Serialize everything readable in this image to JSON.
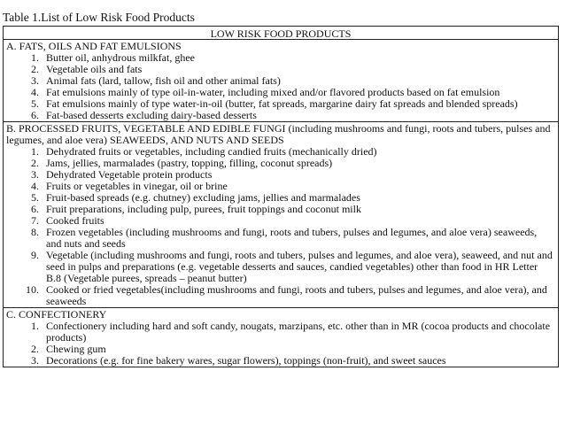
{
  "caption": "Table 1.List of Low Risk Food Products",
  "table_header": "LOW RISK FOOD PRODUCTS",
  "sections": [
    {
      "title": "A. FATS, OILS AND FAT EMULSIONS",
      "items": [
        {
          "num": "1.",
          "text": "Butter oil, anhydrous milkfat, ghee"
        },
        {
          "num": "2.",
          "text": "Vegetable oils and fats"
        },
        {
          "num": "3.",
          "text": "Animal fats (lard, tallow, fish oil and other animal fats)"
        },
        {
          "num": "4.",
          "text": "Fat emulsions mainly of type oil-in-water, including mixed and/or flavored products based on fat emulsion"
        },
        {
          "num": "5.",
          "text": "Fat emulsions mainly of type water-in-oil (butter, fat spreads, margarine dairy fat spreads and blended spreads)"
        },
        {
          "num": "6.",
          "text": "Fat-based desserts excluding dairy-based desserts"
        }
      ]
    },
    {
      "title": "B. PROCESSED FRUITS, VEGETABLE AND EDIBLE FUNGI (including mushrooms and  fungi, roots and tubers, pulses and legumes, and aloe vera) SEAWEEDS, AND NUTS AND SEEDS",
      "items": [
        {
          "num": "1.",
          "text": "Dehydrated fruits or vegetables, including candied fruits (mechanically dried)"
        },
        {
          "num": "2.",
          "text": "Jams, jellies, marmalades (pastry, topping, filling, coconut spreads)"
        },
        {
          "num": "3.",
          "text": "Dehydrated Vegetable protein products"
        },
        {
          "num": "4.",
          "text": "Fruits or vegetables  in vinegar, oil or brine"
        },
        {
          "num": "5.",
          "text": "Fruit-based spreads (e.g. chutney) excluding jams, jellies and marmalades"
        },
        {
          "num": "6.",
          "text": "Fruit preparations, including pulp, purees, fruit toppings and coconut milk"
        },
        {
          "num": "7.",
          "text": "Cooked  fruits"
        },
        {
          "num": "8.",
          "text": "Frozen vegetables (including mushrooms and  fungi, roots and tubers, pulses and legumes, and aloe vera) seaweeds, and nuts and seeds"
        },
        {
          "num": "9.",
          "text": "Vegetable (including mushrooms and fungi, roots and tubers, pulses and legumes,  and aloe vera), seaweed, and nut and seed in pulps and preparations (e.g. vegetable desserts and  sauces, candied vegetables) other than food in HR Letter B.8 (Vegetable purees, spreads – peanut butter)"
        },
        {
          "num": "10.",
          "text": "Cooked or fried vegetables(including mushrooms and fungi, roots and  tubers, pulses and legumes, and aloe vera), and seaweeds"
        }
      ]
    },
    {
      "title": "C. CONFECTIONERY",
      "items": [
        {
          "num": "1.",
          "text": "Confectionery including hard and  soft candy, nougats, marzipans, etc. other than in MR (cocoa products and chocolate products)"
        },
        {
          "num": "2.",
          "text": "Chewing gum"
        },
        {
          "num": "3.",
          "text": "Decorations (e.g. for fine  bakery wares, sugar flowers), toppings (non-fruit), and sweet sauces"
        }
      ]
    }
  ]
}
